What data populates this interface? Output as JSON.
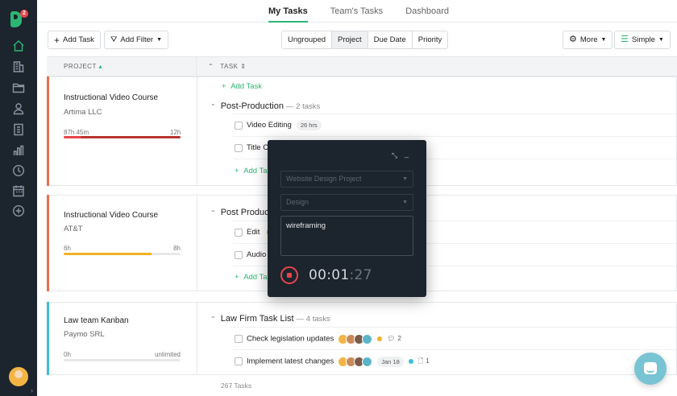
{
  "nav": {
    "tabs": [
      {
        "label": "My Tasks",
        "active": true
      },
      {
        "label": "Team's Tasks",
        "active": false
      },
      {
        "label": "Dashboard",
        "active": false
      }
    ]
  },
  "sidebar": {
    "logo_badge": "2",
    "icons": [
      "home-icon",
      "building-icon",
      "folder-icon",
      "user-icon",
      "invoice-icon",
      "bar-chart-icon",
      "clock-icon",
      "calendar-icon",
      "plus-circle-icon"
    ]
  },
  "toolbar": {
    "add_task": "Add Task",
    "add_filter": "Add Filter",
    "group_by": [
      "Ungrouped",
      "Project",
      "Due Date",
      "Priority"
    ],
    "group_active": "Project",
    "more": "More",
    "view": "Simple"
  },
  "table": {
    "col_project": "PROJECT",
    "col_task": "TASK"
  },
  "groups": [
    {
      "project": "Instructional Video Course",
      "client": "Artima LLC",
      "logged": "87h 45m",
      "budget": "12h",
      "progress": 1.0,
      "bar_color": "#e8704a",
      "fill_color": "#b9342f",
      "add_task_top": "Add Task",
      "list": "Post-Production",
      "list_count": "— 2 tasks",
      "tasks": [
        {
          "name": "Video Editing",
          "tag": "26 hrs"
        },
        {
          "name": "Title Card"
        }
      ],
      "add_task_bottom": "Add Task"
    },
    {
      "project": "Instructional Video Course",
      "client": "AT&T",
      "logged": "6h",
      "budget": "8h",
      "progress": 0.75,
      "bar_color": "#e8704a",
      "fill_color": "#f2b127",
      "list": "Post Production",
      "tasks": [
        {
          "name": "Edit"
        },
        {
          "name": "Audio Mix"
        }
      ],
      "add_task_bottom": "Add Task"
    },
    {
      "project": "Law team Kanban",
      "client": "Paymo SRL",
      "logged": "0h",
      "budget": "unlimited",
      "progress": 0.0,
      "bar_color": "#3bbfd4",
      "fill_color": "#3bbfd4",
      "list": "Law Firm Task List",
      "list_count": "— 4 tasks",
      "tasks": [
        {
          "name": "Check legislation updates",
          "comments": "2"
        },
        {
          "name": "Implement latest changes",
          "date": "Jan 18",
          "files": "1"
        }
      ]
    }
  ],
  "footer": {
    "count": "267 Tasks"
  },
  "timer": {
    "project_placeholder": "Website Design Project",
    "tasklist_placeholder": "Design",
    "description": "wireframing",
    "time_main": "00:01",
    "time_sec": ":27"
  }
}
